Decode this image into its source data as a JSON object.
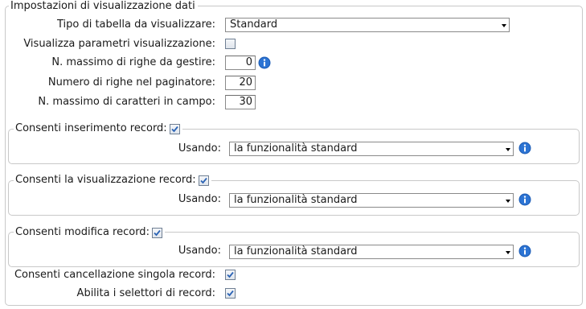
{
  "display_settings": {
    "legend": "Impostazioni di visualizzazione dati",
    "table_type": {
      "label": "Tipo di tabella da visualizzare:",
      "value": "Standard"
    },
    "show_display_params": {
      "label": "Visualizza parametri visualizzazione:",
      "checked": false
    },
    "max_rows": {
      "label": "N. massimo di righe da gestire:",
      "value": "0"
    },
    "pager_rows": {
      "label": "Numero di righe nel paginatore:",
      "value": "20"
    },
    "max_chars": {
      "label": "N. massimo di caratteri in campo:",
      "value": "30"
    }
  },
  "insert_record": {
    "legend": "Consenti inserimento record:",
    "checked": true,
    "using_label": "Usando:",
    "using_value": "la funzionalità standard"
  },
  "view_record": {
    "legend": "Consenti la visualizzazione record:",
    "checked": true,
    "using_label": "Usando:",
    "using_value": "la funzionalità standard"
  },
  "edit_record": {
    "legend": "Consenti modifica record:",
    "checked": true,
    "using_label": "Usando:",
    "using_value": "la funzionalità standard"
  },
  "delete_single_record": {
    "label": "Consenti cancellazione singola record:",
    "checked": true
  },
  "record_selectors": {
    "label": "Abilita i selettori di record:",
    "checked": true
  },
  "icons": {
    "info": "info-icon",
    "dropdown": "chevron-down-icon",
    "checkmark": "checkmark-icon"
  },
  "colors": {
    "info_blue": "#1f5fb8",
    "border": "#c8c8c8",
    "check_blue": "#2b63b5"
  }
}
